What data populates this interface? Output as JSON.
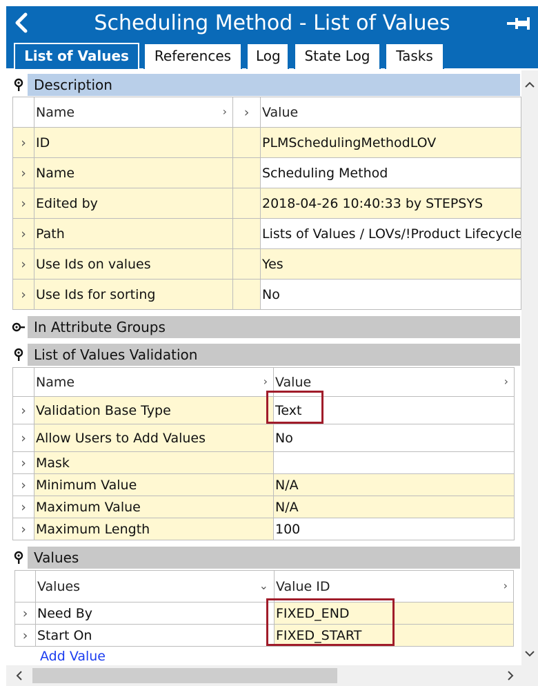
{
  "window": {
    "title": "Scheduling Method - List of Values"
  },
  "tabs": [
    {
      "label": "List of Values",
      "active": true
    },
    {
      "label": "References",
      "active": false
    },
    {
      "label": "Log",
      "active": false
    },
    {
      "label": "State Log",
      "active": false
    },
    {
      "label": "Tasks",
      "active": false
    }
  ],
  "description": {
    "header": "Description",
    "col_name": "Name",
    "col_value": "Value",
    "rows": [
      {
        "name": "ID",
        "value": "PLMSchedulingMethodLOV"
      },
      {
        "name": "Name",
        "value": "Scheduling Method"
      },
      {
        "name": "Edited by",
        "value": "2018-04-26 10:40:33 by STEPSYS"
      },
      {
        "name": "Path",
        "value": "Lists of Values / LOVs/!Product Lifecycle"
      },
      {
        "name": "Use Ids on values",
        "value": "Yes"
      },
      {
        "name": "Use Ids for sorting",
        "value": "No"
      }
    ]
  },
  "attribute_groups": {
    "header": "In Attribute Groups"
  },
  "validation": {
    "header": "List of Values Validation",
    "col_name": "Name",
    "col_value": "Value",
    "rows": [
      {
        "name": "Validation Base Type",
        "value": "Text"
      },
      {
        "name": "Allow Users to Add Values",
        "value": "No"
      },
      {
        "name": "Mask",
        "value": ""
      },
      {
        "name": "Minimum Value",
        "value": "N/A"
      },
      {
        "name": "Maximum Value",
        "value": "N/A"
      },
      {
        "name": "Maximum Length",
        "value": "100"
      }
    ]
  },
  "values": {
    "header": "Values",
    "col_values": "Values",
    "col_value_id": "Value ID",
    "rows": [
      {
        "value": "Need By",
        "value_id": "FIXED_END"
      },
      {
        "value": "Start On",
        "value_id": "FIXED_START"
      }
    ],
    "add_value_link": "Add Value"
  },
  "icons": {
    "back": "chevron-left-icon",
    "pin": "pin-icon",
    "section_expanded": "pin-down-icon",
    "section_collapsed": "pin-right-icon"
  },
  "colors": {
    "accent": "#0a6ab8",
    "highlight_box": "#a01c2a",
    "row_yellow": "#fff8d2",
    "desc_header": "#b9cfe9",
    "section_gray": "#c8c8c8",
    "link": "#1a3cf0"
  }
}
